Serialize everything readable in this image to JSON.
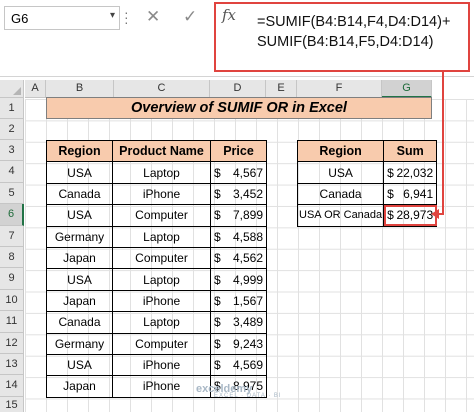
{
  "name_box": {
    "cell_ref": "G6"
  },
  "formula_bar": {
    "cancel_glyph": "✕",
    "enter_glyph": "✓",
    "fx_label": "fx",
    "formula": "=SUMIF(B4:B14,F4,D4:D14)+\nSUMIF(B4:B14,F5,D4:D14)"
  },
  "columns": [
    "A",
    "B",
    "C",
    "D",
    "E",
    "F",
    "G"
  ],
  "selected_column": "G",
  "rows": [
    "1",
    "2",
    "3",
    "4",
    "5",
    "6",
    "7",
    "8",
    "9",
    "10",
    "11",
    "12",
    "13",
    "14",
    "15"
  ],
  "selected_row": "6",
  "title": "Overview of SUMIF OR in Excel",
  "main_table": {
    "headers": [
      "Region",
      "Product Name",
      "Price"
    ],
    "rows": [
      {
        "region": "USA",
        "product": "Laptop",
        "currency": "$",
        "price": "4,567"
      },
      {
        "region": "Canada",
        "product": "iPhone",
        "currency": "$",
        "price": "3,452"
      },
      {
        "region": "USA",
        "product": "Computer",
        "currency": "$",
        "price": "7,899"
      },
      {
        "region": "Germany",
        "product": "Laptop",
        "currency": "$",
        "price": "4,588"
      },
      {
        "region": "Japan",
        "product": "Computer",
        "currency": "$",
        "price": "4,562"
      },
      {
        "region": "USA",
        "product": "Laptop",
        "currency": "$",
        "price": "4,999"
      },
      {
        "region": "Japan",
        "product": "iPhone",
        "currency": "$",
        "price": "1,567"
      },
      {
        "region": "Canada",
        "product": "Laptop",
        "currency": "$",
        "price": "3,489"
      },
      {
        "region": "Germany",
        "product": "Computer",
        "currency": "$",
        "price": "9,243"
      },
      {
        "region": "USA",
        "product": "iPhone",
        "currency": "$",
        "price": "4,569"
      },
      {
        "region": "Japan",
        "product": "iPhone",
        "currency": "$",
        "price": "8,975"
      }
    ]
  },
  "sum_table": {
    "headers": [
      "Region",
      "Sum"
    ],
    "rows": [
      {
        "region": "USA",
        "currency": "$",
        "sum": "22,032"
      },
      {
        "region": "Canada",
        "currency": "$",
        "sum": "6,941"
      },
      {
        "region": "USA OR Canada",
        "currency": "$",
        "sum": "28,973"
      }
    ]
  },
  "watermark": {
    "brand": "exceldemy",
    "tagline": "EXCEL · DATA · BI"
  },
  "colors": {
    "header_fill": "#f8cbad",
    "highlight": "#e0443f",
    "selection": "#217346"
  }
}
